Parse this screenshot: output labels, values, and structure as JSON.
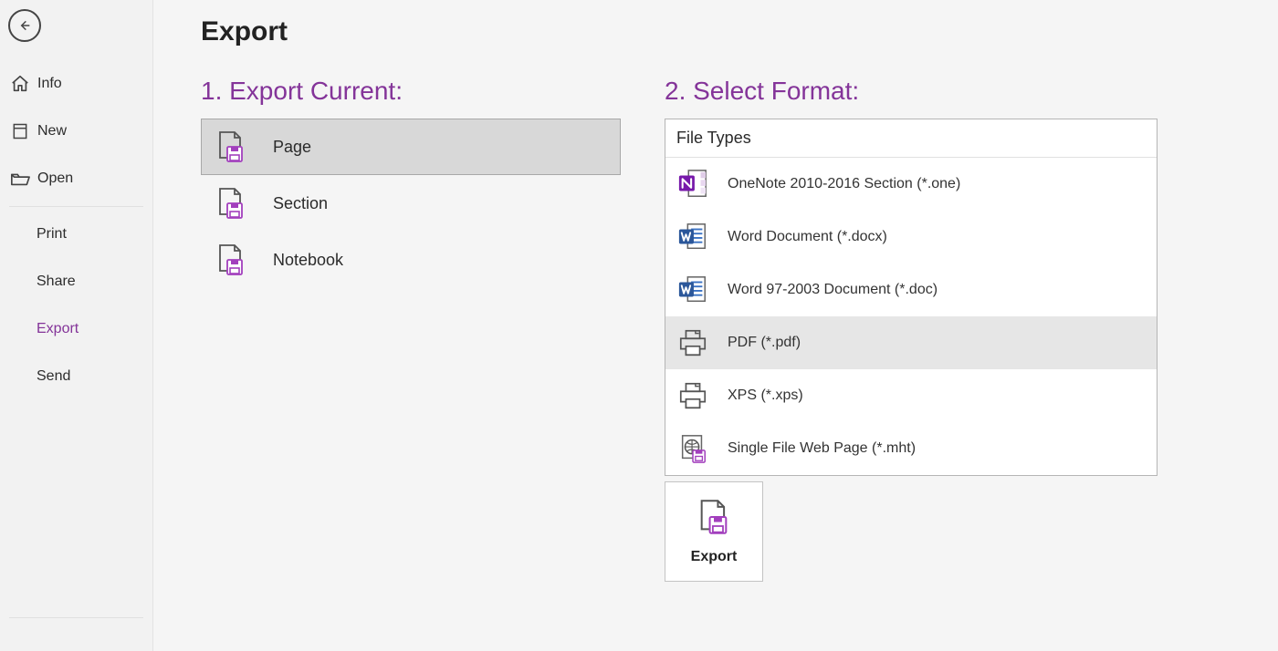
{
  "accent_color": "#843499",
  "sidebar": {
    "back_label": "Back",
    "items_top": [
      {
        "id": "info",
        "label": "Info"
      },
      {
        "id": "new",
        "label": "New"
      },
      {
        "id": "open",
        "label": "Open"
      }
    ],
    "items_bottom": [
      {
        "id": "print",
        "label": "Print"
      },
      {
        "id": "share",
        "label": "Share"
      },
      {
        "id": "export",
        "label": "Export"
      },
      {
        "id": "send",
        "label": "Send"
      }
    ],
    "active_id": "export"
  },
  "page": {
    "title": "Export",
    "section1_heading": "1. Export Current:",
    "section2_heading": "2. Select Format:",
    "file_types_header": "File Types",
    "export_button": "Export"
  },
  "export_current": {
    "items": [
      {
        "id": "page",
        "label": "Page"
      },
      {
        "id": "section",
        "label": "Section"
      },
      {
        "id": "notebook",
        "label": "Notebook"
      }
    ],
    "selected_id": "page"
  },
  "formats": {
    "items": [
      {
        "id": "one",
        "label": "OneNote 2010-2016 Section (*.one)"
      },
      {
        "id": "docx",
        "label": "Word Document (*.docx)"
      },
      {
        "id": "doc",
        "label": "Word 97-2003 Document (*.doc)"
      },
      {
        "id": "pdf",
        "label": "PDF (*.pdf)"
      },
      {
        "id": "xps",
        "label": "XPS (*.xps)"
      },
      {
        "id": "mht",
        "label": "Single File Web Page (*.mht)"
      }
    ],
    "selected_id": "pdf"
  }
}
